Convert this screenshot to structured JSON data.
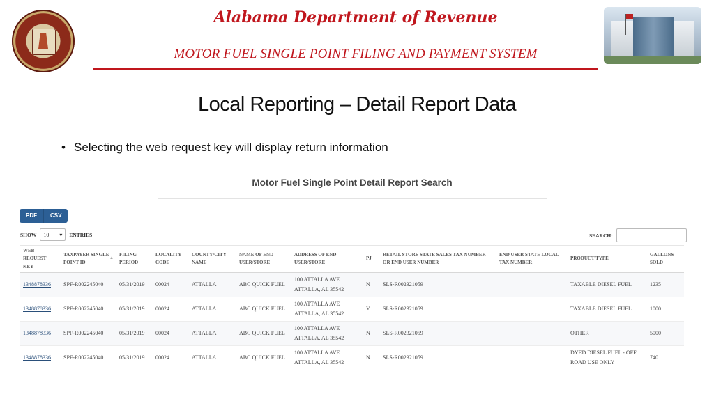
{
  "header": {
    "org_title": "Alabama Department of Revenue",
    "system_title": "MOTOR FUEL SINGLE POINT FILING AND PAYMENT SYSTEM",
    "accent_color": "#c0161d"
  },
  "slide": {
    "title": "Local Reporting – Detail Report Data",
    "bullet": "Selecting the web request key will display return information"
  },
  "report": {
    "title": "Motor Fuel Single Point Detail Report Search",
    "export_buttons": [
      "PDF",
      "CSV"
    ],
    "show_label": "SHOW",
    "entries_value": "10",
    "entries_label": "ENTRIES",
    "search_label": "SEARCH:",
    "search_value": "",
    "columns": [
      "WEB REQUEST KEY",
      "TAXPAYER SINGLE POINT ID",
      "FILING PERIOD",
      "LOCALITY CODE",
      "COUNTY/CITY NAME",
      "NAME OF END USER/STORE",
      "ADDRESS OF END USER/STORE",
      "PJ",
      "RETAIL STORE STATE SALES TAX NUMBER OR END USER NUMBER",
      "END USER STATE LOCAL TAX NUMBER",
      "PRODUCT TYPE",
      "GALLONS SOLD"
    ],
    "rows": [
      {
        "web_request_key": "1348878336",
        "taxpayer_id": "SPF-R002245040",
        "filing_period": "05/31/2019",
        "locality_code": "00024",
        "county_city": "ATTALLA",
        "end_user_name": "ABC QUICK FUEL",
        "address_line1": "100 ATTALLA AVE",
        "address_line2": "ATTALLA, AL 35542",
        "pj": "N",
        "sales_tax_number": "SLS-R002321059",
        "local_tax_number": "",
        "product_type": "TAXABLE DIESEL FUEL",
        "gallons": "1235"
      },
      {
        "web_request_key": "1348878336",
        "taxpayer_id": "SPF-R002245040",
        "filing_period": "05/31/2019",
        "locality_code": "00024",
        "county_city": "ATTALLA",
        "end_user_name": "ABC QUICK FUEL",
        "address_line1": "100 ATTALLA AVE",
        "address_line2": "ATTALLA, AL 35542",
        "pj": "Y",
        "sales_tax_number": "SLS-R002321059",
        "local_tax_number": "",
        "product_type": "TAXABLE DIESEL FUEL",
        "gallons": "1000"
      },
      {
        "web_request_key": "1348878336",
        "taxpayer_id": "SPF-R002245040",
        "filing_period": "05/31/2019",
        "locality_code": "00024",
        "county_city": "ATTALLA",
        "end_user_name": "ABC QUICK FUEL",
        "address_line1": "100 ATTALLA AVE",
        "address_line2": "ATTALLA, AL 35542",
        "pj": "N",
        "sales_tax_number": "SLS-R002321059",
        "local_tax_number": "",
        "product_type": "OTHER",
        "gallons": "5000"
      },
      {
        "web_request_key": "1348878336",
        "taxpayer_id": "SPF-R002245040",
        "filing_period": "05/31/2019",
        "locality_code": "00024",
        "county_city": "ATTALLA",
        "end_user_name": "ABC QUICK FUEL",
        "address_line1": "100 ATTALLA AVE",
        "address_line2": "ATTALLA, AL 35542",
        "pj": "N",
        "sales_tax_number": "SLS-R002321059",
        "local_tax_number": "",
        "product_type": "DYED DIESEL FUEL - OFF ROAD USE ONLY",
        "gallons": "740"
      }
    ]
  }
}
